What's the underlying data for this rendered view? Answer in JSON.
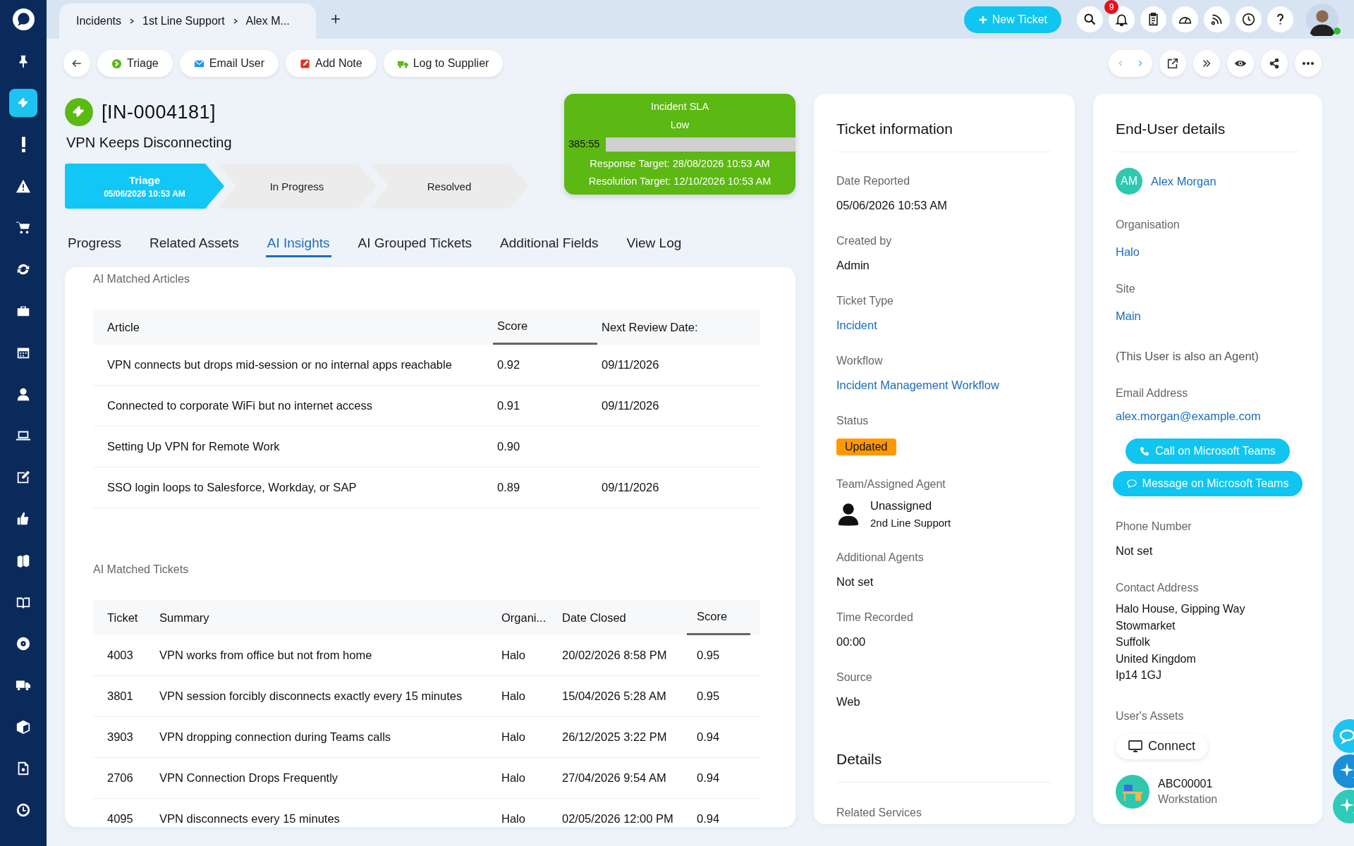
{
  "sidebar": {
    "items": [
      {
        "selected": false
      },
      {
        "selected": true
      },
      {
        "selected": false
      },
      {
        "selected": false
      },
      {
        "selected": false
      },
      {
        "selected": false
      },
      {
        "selected": false
      },
      {
        "selected": false
      },
      {
        "selected": false
      },
      {
        "selected": false
      },
      {
        "selected": false
      },
      {
        "selected": false
      },
      {
        "selected": false
      },
      {
        "selected": false
      },
      {
        "selected": false
      },
      {
        "selected": false
      },
      {
        "selected": false
      },
      {
        "selected": false
      },
      {
        "selected": false
      }
    ]
  },
  "breadcrumb": [
    "Incidents",
    "1st Line Support",
    "Alex M..."
  ],
  "new_ticket_button": "New Ticket",
  "notifications_badge": "9",
  "user": {
    "online": true
  },
  "toolbar_actions": [
    "Triage",
    "Email User",
    "Add Note",
    "Log to Supplier"
  ],
  "ticket": {
    "id": "[IN-0004181]",
    "summary": "VPN Keeps Disconnecting"
  },
  "stages": [
    {
      "label": "Triage",
      "date": "05/06/2026 10:53 AM",
      "selected": true
    },
    {
      "label": "In Progress",
      "selected": false
    },
    {
      "label": "Resolved",
      "selected": false
    }
  ],
  "sla": {
    "title": "Incident SLA",
    "priority": "Low",
    "timer": "385:55",
    "level": 0.18,
    "response_target": "Response Target: 28/08/2026 10:53 AM",
    "resolution_target": "Resolution Target: 12/10/2026 10:53 AM"
  },
  "tabs": [
    {
      "label": "Progress",
      "selected": false
    },
    {
      "label": "Related Assets",
      "selected": false
    },
    {
      "label": "AI Insights",
      "selected": true
    },
    {
      "label": "AI Grouped Tickets",
      "selected": false
    },
    {
      "label": "Additional Fields",
      "selected": false
    },
    {
      "label": "View Log",
      "selected": false
    }
  ],
  "articles": {
    "title": "AI Matched Articles",
    "columns": [
      {
        "label": "Article",
        "sorted": false
      },
      {
        "label": "Score",
        "sorted": true
      },
      {
        "label": "Next Review Date:",
        "sorted": false
      }
    ],
    "rows": [
      {
        "article": "VPN connects but drops mid-session or no internal apps reachable",
        "score": "0.92",
        "review_date": "09/11/2026"
      },
      {
        "article": "Connected to corporate WiFi but no internet access",
        "score": "0.91",
        "review_date": "09/11/2026"
      },
      {
        "article": "Setting Up VPN for Remote Work",
        "score": "0.90"
      },
      {
        "article": "SSO login loops to Salesforce, Workday, or SAP",
        "score": "0.89",
        "review_date": "09/11/2026"
      }
    ]
  },
  "tickets": {
    "title": "AI Matched Tickets",
    "columns": [
      {
        "label": "Ticket",
        "sorted": false
      },
      {
        "label": "Summary",
        "sorted": false
      },
      {
        "label": "Organi...",
        "sorted": false
      },
      {
        "label": "Date Closed",
        "sorted": false
      },
      {
        "label": "Score",
        "sorted": true
      }
    ],
    "rows": [
      [
        "4003",
        "VPN works from office but not from home",
        "Halo",
        "20/02/2026 8:58 PM",
        "0.95"
      ],
      [
        "3801",
        "VPN session forcibly disconnects exactly every 15 minutes",
        "Halo",
        "15/04/2026 5:28 AM",
        "0.95"
      ],
      [
        "3903",
        "VPN dropping connection during Teams calls",
        "Halo",
        "26/12/2025 3:22 PM",
        "0.94"
      ],
      [
        "2706",
        "VPN Connection Drops Frequently",
        "Halo",
        "27/04/2026 9:54 AM",
        "0.94"
      ],
      [
        "4095",
        "VPN disconnects every 15 minutes",
        "Halo",
        "02/05/2026 12:00 PM",
        "0.94"
      ]
    ]
  },
  "ticket_information": {
    "title": "Ticket information",
    "fields": [
      {
        "label": "Date Reported",
        "value": "05/06/2026 10:53 AM",
        "kind": "text"
      },
      {
        "label": "Created by",
        "value": "Admin",
        "kind": "text"
      },
      {
        "label": "Ticket Type",
        "value": "Incident",
        "kind": "link"
      },
      {
        "label": "Workflow",
        "value": "Incident Management Workflow",
        "kind": "link"
      },
      {
        "label": "Status",
        "value": "Updated",
        "kind": "badge"
      },
      {
        "label": "Team/Assigned Agent",
        "value": "Unassigned",
        "team": "2nd Line Support",
        "kind": "agent"
      },
      {
        "label": "Additional Agents",
        "value": "Not set",
        "kind": "text"
      },
      {
        "label": "Time Recorded",
        "value": "00:00",
        "kind": "text"
      },
      {
        "label": "Source",
        "value": "Web",
        "kind": "text"
      }
    ],
    "details_title": "Details",
    "related_services": "Related Services"
  },
  "end_user": {
    "title": "End-User details",
    "initials": "AM",
    "name": "Alex Morgan",
    "organisation_label": "Organisation",
    "organisation": "Halo",
    "site_label": "Site",
    "site": "Main",
    "agent_note": "(This User is also an Agent)",
    "email_label": "Email Address",
    "email": "alex.morgan@example.com",
    "call_button": "Call on Microsoft Teams",
    "message_button": "Message on Microsoft Teams",
    "phone_label": "Phone Number",
    "phone": "Not set",
    "address_label": "Contact Address",
    "address": [
      "Halo House, Gipping Way",
      "Stowmarket",
      "Suffolk",
      "United Kingdom",
      "Ip14 1GJ"
    ],
    "assets_label": "User's Assets",
    "connect_button": "Connect",
    "asset": {
      "id": "ABC00001",
      "type": "Workstation"
    }
  }
}
